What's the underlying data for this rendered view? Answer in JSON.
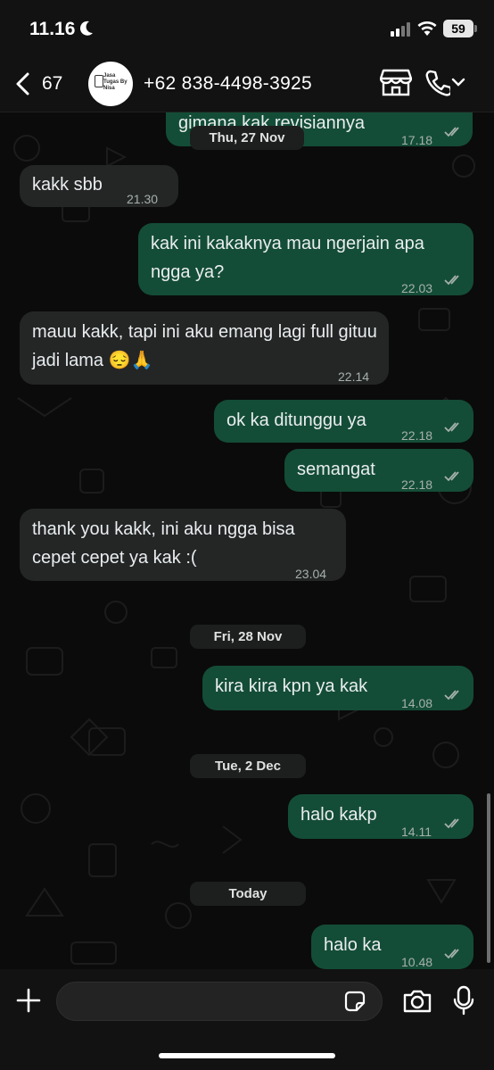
{
  "status_bar": {
    "time": "11.16",
    "battery": "59"
  },
  "header": {
    "back_count": "67",
    "contact_name": "+62 838-4498-3925",
    "avatar_text": "Jasa Tugas By Nisa"
  },
  "messages": [
    {
      "dir": "out",
      "text": "gimana kak revisiannya",
      "time": "17.18"
    },
    {
      "dir": "in",
      "text": "kakk sbb",
      "time": "21.30"
    },
    {
      "dir": "out",
      "text": "kak ini kakaknya mau ngerjain apa ngga ya?",
      "time": "22.03"
    },
    {
      "dir": "in",
      "text": "mauu kakk, tapi ini aku emang lagi full gituu jadi lama 😔🙏",
      "time": "22.14"
    },
    {
      "dir": "out",
      "text": "ok ka ditunggu ya",
      "time": "22.18"
    },
    {
      "dir": "out",
      "text": "semangat",
      "time": "22.18"
    },
    {
      "dir": "in",
      "text": "thank you kakk, ini aku ngga bisa cepet cepet ya kak :(",
      "time": "23.04"
    },
    {
      "dir": "out",
      "text": "kira kira kpn ya kak",
      "time": "14.08"
    },
    {
      "dir": "out",
      "text": "halo kakp",
      "time": "14.11"
    },
    {
      "dir": "out",
      "text": "halo ka",
      "time": "10.48"
    }
  ],
  "dates": [
    "Thu, 27 Nov",
    "Fri, 28 Nov",
    "Tue, 2 Dec",
    "Today"
  ],
  "footer": {
    "input_placeholder": ""
  },
  "colors": {
    "incoming_bubble": "#242626",
    "outgoing_bubble": "#144d37",
    "read_ticks": "#a5b1ab",
    "background": "#0b0b0b"
  }
}
